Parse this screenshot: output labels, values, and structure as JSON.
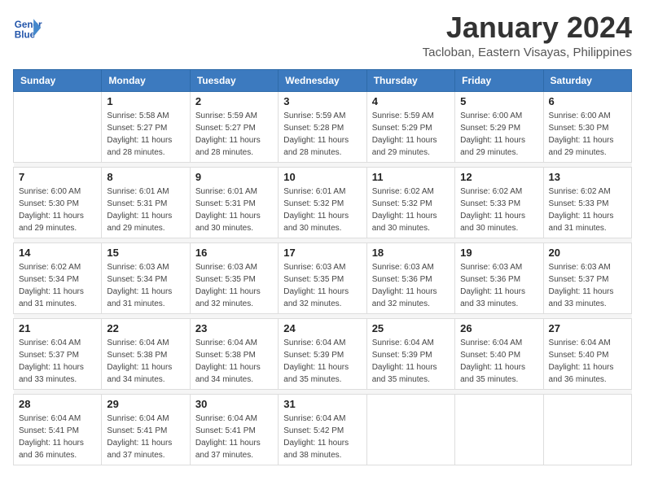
{
  "header": {
    "logo_line1": "General",
    "logo_line2": "Blue",
    "month_year": "January 2024",
    "location": "Tacloban, Eastern Visayas, Philippines"
  },
  "weekdays": [
    "Sunday",
    "Monday",
    "Tuesday",
    "Wednesday",
    "Thursday",
    "Friday",
    "Saturday"
  ],
  "weeks": [
    [
      {
        "day": "",
        "info": ""
      },
      {
        "day": "1",
        "info": "Sunrise: 5:58 AM\nSunset: 5:27 PM\nDaylight: 11 hours\nand 28 minutes."
      },
      {
        "day": "2",
        "info": "Sunrise: 5:59 AM\nSunset: 5:27 PM\nDaylight: 11 hours\nand 28 minutes."
      },
      {
        "day": "3",
        "info": "Sunrise: 5:59 AM\nSunset: 5:28 PM\nDaylight: 11 hours\nand 28 minutes."
      },
      {
        "day": "4",
        "info": "Sunrise: 5:59 AM\nSunset: 5:29 PM\nDaylight: 11 hours\nand 29 minutes."
      },
      {
        "day": "5",
        "info": "Sunrise: 6:00 AM\nSunset: 5:29 PM\nDaylight: 11 hours\nand 29 minutes."
      },
      {
        "day": "6",
        "info": "Sunrise: 6:00 AM\nSunset: 5:30 PM\nDaylight: 11 hours\nand 29 minutes."
      }
    ],
    [
      {
        "day": "7",
        "info": "Sunrise: 6:00 AM\nSunset: 5:30 PM\nDaylight: 11 hours\nand 29 minutes."
      },
      {
        "day": "8",
        "info": "Sunrise: 6:01 AM\nSunset: 5:31 PM\nDaylight: 11 hours\nand 29 minutes."
      },
      {
        "day": "9",
        "info": "Sunrise: 6:01 AM\nSunset: 5:31 PM\nDaylight: 11 hours\nand 30 minutes."
      },
      {
        "day": "10",
        "info": "Sunrise: 6:01 AM\nSunset: 5:32 PM\nDaylight: 11 hours\nand 30 minutes."
      },
      {
        "day": "11",
        "info": "Sunrise: 6:02 AM\nSunset: 5:32 PM\nDaylight: 11 hours\nand 30 minutes."
      },
      {
        "day": "12",
        "info": "Sunrise: 6:02 AM\nSunset: 5:33 PM\nDaylight: 11 hours\nand 30 minutes."
      },
      {
        "day": "13",
        "info": "Sunrise: 6:02 AM\nSunset: 5:33 PM\nDaylight: 11 hours\nand 31 minutes."
      }
    ],
    [
      {
        "day": "14",
        "info": "Sunrise: 6:02 AM\nSunset: 5:34 PM\nDaylight: 11 hours\nand 31 minutes."
      },
      {
        "day": "15",
        "info": "Sunrise: 6:03 AM\nSunset: 5:34 PM\nDaylight: 11 hours\nand 31 minutes."
      },
      {
        "day": "16",
        "info": "Sunrise: 6:03 AM\nSunset: 5:35 PM\nDaylight: 11 hours\nand 32 minutes."
      },
      {
        "day": "17",
        "info": "Sunrise: 6:03 AM\nSunset: 5:35 PM\nDaylight: 11 hours\nand 32 minutes."
      },
      {
        "day": "18",
        "info": "Sunrise: 6:03 AM\nSunset: 5:36 PM\nDaylight: 11 hours\nand 32 minutes."
      },
      {
        "day": "19",
        "info": "Sunrise: 6:03 AM\nSunset: 5:36 PM\nDaylight: 11 hours\nand 33 minutes."
      },
      {
        "day": "20",
        "info": "Sunrise: 6:03 AM\nSunset: 5:37 PM\nDaylight: 11 hours\nand 33 minutes."
      }
    ],
    [
      {
        "day": "21",
        "info": "Sunrise: 6:04 AM\nSunset: 5:37 PM\nDaylight: 11 hours\nand 33 minutes."
      },
      {
        "day": "22",
        "info": "Sunrise: 6:04 AM\nSunset: 5:38 PM\nDaylight: 11 hours\nand 34 minutes."
      },
      {
        "day": "23",
        "info": "Sunrise: 6:04 AM\nSunset: 5:38 PM\nDaylight: 11 hours\nand 34 minutes."
      },
      {
        "day": "24",
        "info": "Sunrise: 6:04 AM\nSunset: 5:39 PM\nDaylight: 11 hours\nand 35 minutes."
      },
      {
        "day": "25",
        "info": "Sunrise: 6:04 AM\nSunset: 5:39 PM\nDaylight: 11 hours\nand 35 minutes."
      },
      {
        "day": "26",
        "info": "Sunrise: 6:04 AM\nSunset: 5:40 PM\nDaylight: 11 hours\nand 35 minutes."
      },
      {
        "day": "27",
        "info": "Sunrise: 6:04 AM\nSunset: 5:40 PM\nDaylight: 11 hours\nand 36 minutes."
      }
    ],
    [
      {
        "day": "28",
        "info": "Sunrise: 6:04 AM\nSunset: 5:41 PM\nDaylight: 11 hours\nand 36 minutes."
      },
      {
        "day": "29",
        "info": "Sunrise: 6:04 AM\nSunset: 5:41 PM\nDaylight: 11 hours\nand 37 minutes."
      },
      {
        "day": "30",
        "info": "Sunrise: 6:04 AM\nSunset: 5:41 PM\nDaylight: 11 hours\nand 37 minutes."
      },
      {
        "day": "31",
        "info": "Sunrise: 6:04 AM\nSunset: 5:42 PM\nDaylight: 11 hours\nand 38 minutes."
      },
      {
        "day": "",
        "info": ""
      },
      {
        "day": "",
        "info": ""
      },
      {
        "day": "",
        "info": ""
      }
    ]
  ]
}
